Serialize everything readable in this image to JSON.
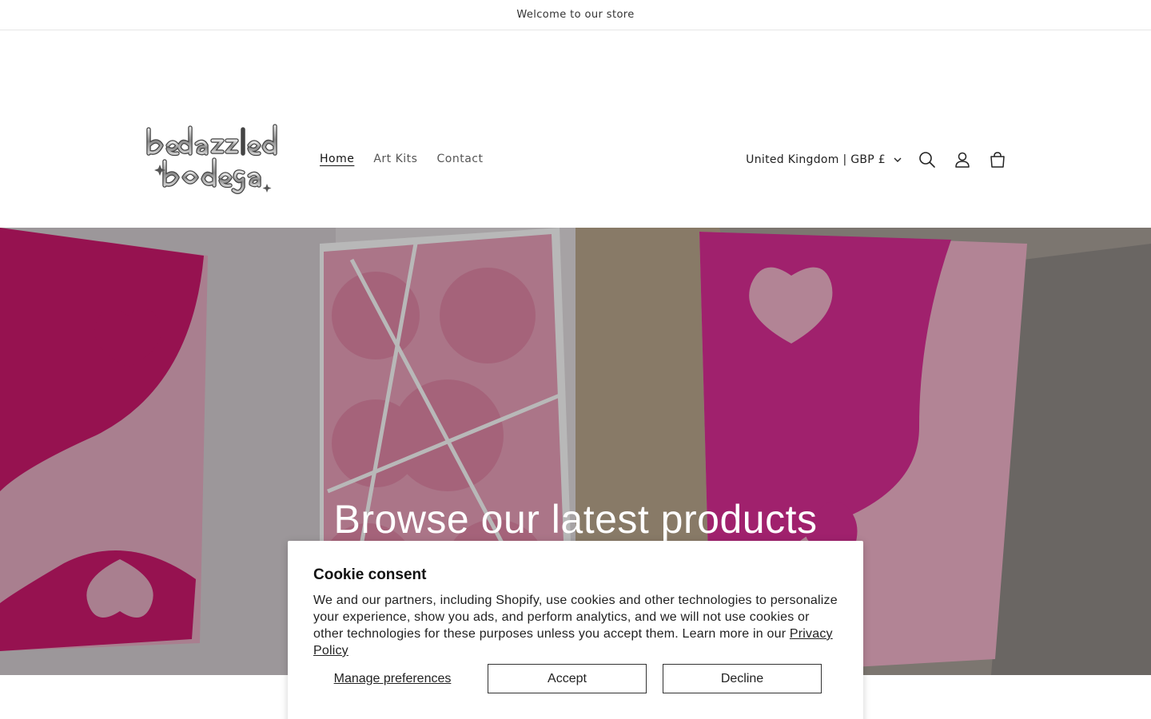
{
  "announcement": "Welcome to our store",
  "logo": {
    "text": "bedazzled bodega"
  },
  "nav": {
    "items": [
      {
        "label": "Home",
        "active": true
      },
      {
        "label": "Art Kits",
        "active": false
      },
      {
        "label": "Contact",
        "active": false
      }
    ]
  },
  "header": {
    "country": "United Kingdom | GBP £",
    "icons": [
      "search-icon",
      "account-icon",
      "cart-icon"
    ]
  },
  "hero": {
    "title": "Browse our latest products"
  },
  "cookie": {
    "title": "Cookie consent",
    "body": "We and our partners, including Shopify, use cookies and other technologies to personalize your experience, show you ads, and perform analytics, and we will not use cookies or other technologies for these purposes unless you accept them. Learn more in our ",
    "link": "Privacy Policy",
    "manage_label": "Manage preferences",
    "accept_label": "Accept",
    "decline_label": "Decline"
  },
  "colors": {
    "hot_pink": "#d0196f",
    "pearl_pink": "#eab0c6",
    "text": "#121212"
  }
}
